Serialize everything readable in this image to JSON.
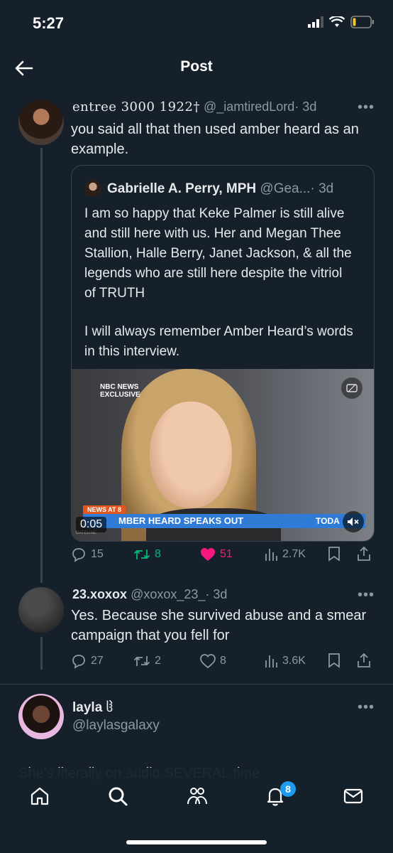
{
  "status": {
    "time": "5:27"
  },
  "header": {
    "title": "Post"
  },
  "reply1": {
    "display_name": "entree 3000 1922†",
    "handle": "@_iamtiredLord",
    "time": "· 3d",
    "text": "you said all that then used amber heard as an example.",
    "more": "•••"
  },
  "quote": {
    "display_name": "Gabrielle A. Perry, MPH",
    "handle": "@Gea...",
    "time": "· 3d",
    "paragraph1": "I am so happy that Keke Palmer is still alive and still here with us. Her and Megan Thee Stallion, Halle Berry, Janet Jackson, & all the legends who are still here despite the vitriol of TRUTH",
    "paragraph2": "I will always remember Amber Heard’s words in this interview.",
    "video": {
      "network_label_1": "NBC NEWS",
      "network_label_2": "EXCLUSIVE",
      "lower_third_tag": "NEWS AT 8",
      "lower_third_text": "MBER HEARD SPEAKS OUT",
      "brand": "TODA",
      "timestamp": "0:05",
      "dateline": "DATELINE"
    }
  },
  "reply1_actions": {
    "replies": "15",
    "reposts": "8",
    "likes": "51",
    "views": "2.7K"
  },
  "reply2": {
    "display_name": "23.xoxox",
    "handle": "@xoxox_23_",
    "time": "· 3d",
    "text": "Yes. Because she survived abuse and a smear campaign that you fell for",
    "more": "•••",
    "actions": {
      "replies": "27",
      "reposts": "2",
      "likes": "8",
      "views": "3.6K"
    }
  },
  "reply3": {
    "display_name": "layla",
    "handle": "@laylasgalaxy",
    "text_partial": "She’s literally on audio SEVERAL time",
    "more": "•••"
  },
  "nav": {
    "notifications_badge": "8"
  },
  "colors": {
    "background": "#15202b",
    "accent": "#1d9bf0",
    "like": "#f91880",
    "repost": "#00ba7c"
  }
}
